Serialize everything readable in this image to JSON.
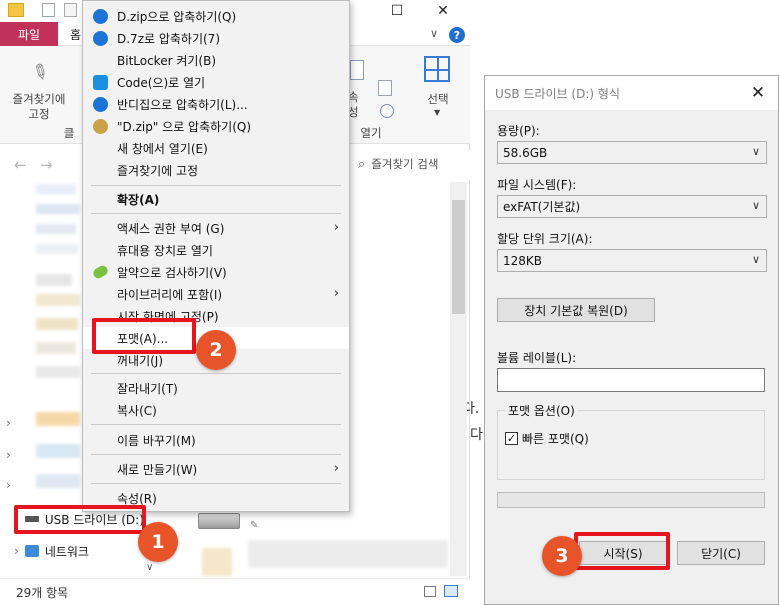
{
  "explorer": {
    "file_tab": "파일",
    "home_tab": "홈",
    "pin_label": "즐겨찾기에 고정",
    "pin_group": "클",
    "ribbon_label_fragment": "속성",
    "open_group": "열기",
    "select_label": "선택",
    "search_placeholder": "즐겨찾기 검색",
    "usb_label": "USB 드라이브 (D:)",
    "network_label": "네트워크",
    "status_count": "29개 항목",
    "right_text_1": "다.",
    "right_text_2": "다"
  },
  "context_menu": {
    "items": [
      {
        "label": "D.zip으로 압축하기(Q)",
        "icon": "bandizip-icon"
      },
      {
        "label": "D.7z로 압축하기(7)",
        "icon": "bandizip-icon"
      },
      {
        "label": "BitLocker 켜기(B)",
        "icon": ""
      },
      {
        "label": "Code(으)로 열기",
        "icon": "vscode-icon"
      },
      {
        "label": "반디집으로 압축하기(L)...",
        "icon": "bandizip-icon"
      },
      {
        "label": "\"D.zip\" 으로 압축하기(Q)",
        "icon": "bandizip-alt-icon"
      },
      {
        "label": "새 창에서 열기(E)",
        "icon": ""
      },
      {
        "label": "즐겨찾기에 고정",
        "icon": ""
      },
      {
        "label": "확장(A)",
        "icon": ""
      },
      {
        "label": "액세스 권한 부여 (G)",
        "icon": ""
      },
      {
        "label": "휴대용 장치로 열기",
        "icon": ""
      },
      {
        "label": "알약으로 검사하기(V)",
        "icon": "alyac-icon"
      },
      {
        "label": "라이브러리에 포함(I)",
        "icon": ""
      },
      {
        "label": "시작 화면에 고정(P)",
        "icon": ""
      },
      {
        "label": "포맷(A)...",
        "icon": ""
      },
      {
        "label": "꺼내기(J)",
        "icon": ""
      },
      {
        "label": "잘라내기(T)",
        "icon": ""
      },
      {
        "label": "복사(C)",
        "icon": ""
      },
      {
        "label": "이름 바꾸기(M)",
        "icon": ""
      },
      {
        "label": "새로 만들기(W)",
        "icon": ""
      },
      {
        "label": "속성(R)",
        "icon": ""
      }
    ]
  },
  "dialog": {
    "title": "USB 드라이브 (D:) 형식",
    "capacity_label": "용량(P):",
    "capacity_value": "58.6GB",
    "fs_label": "파일 시스템(F):",
    "fs_value": "exFAT(기본값)",
    "alloc_label": "할당 단위 크기(A):",
    "alloc_value": "128KB",
    "restore_button": "장치 기본값 복원(D)",
    "volume_label": "볼륨 레이블(L):",
    "volume_value": "",
    "format_options": "포맷 옵션(O)",
    "quick_format": "빠른 포맷(Q)",
    "quick_format_checked": true,
    "start_button": "시작(S)",
    "close_button": "닫기(C)"
  },
  "annotations": {
    "step1": "1",
    "step2": "2",
    "step3": "3"
  },
  "colors": {
    "file_tab": "#c0325a",
    "annotation_red": "#e5141e",
    "badge_orange": "#e8542a"
  }
}
